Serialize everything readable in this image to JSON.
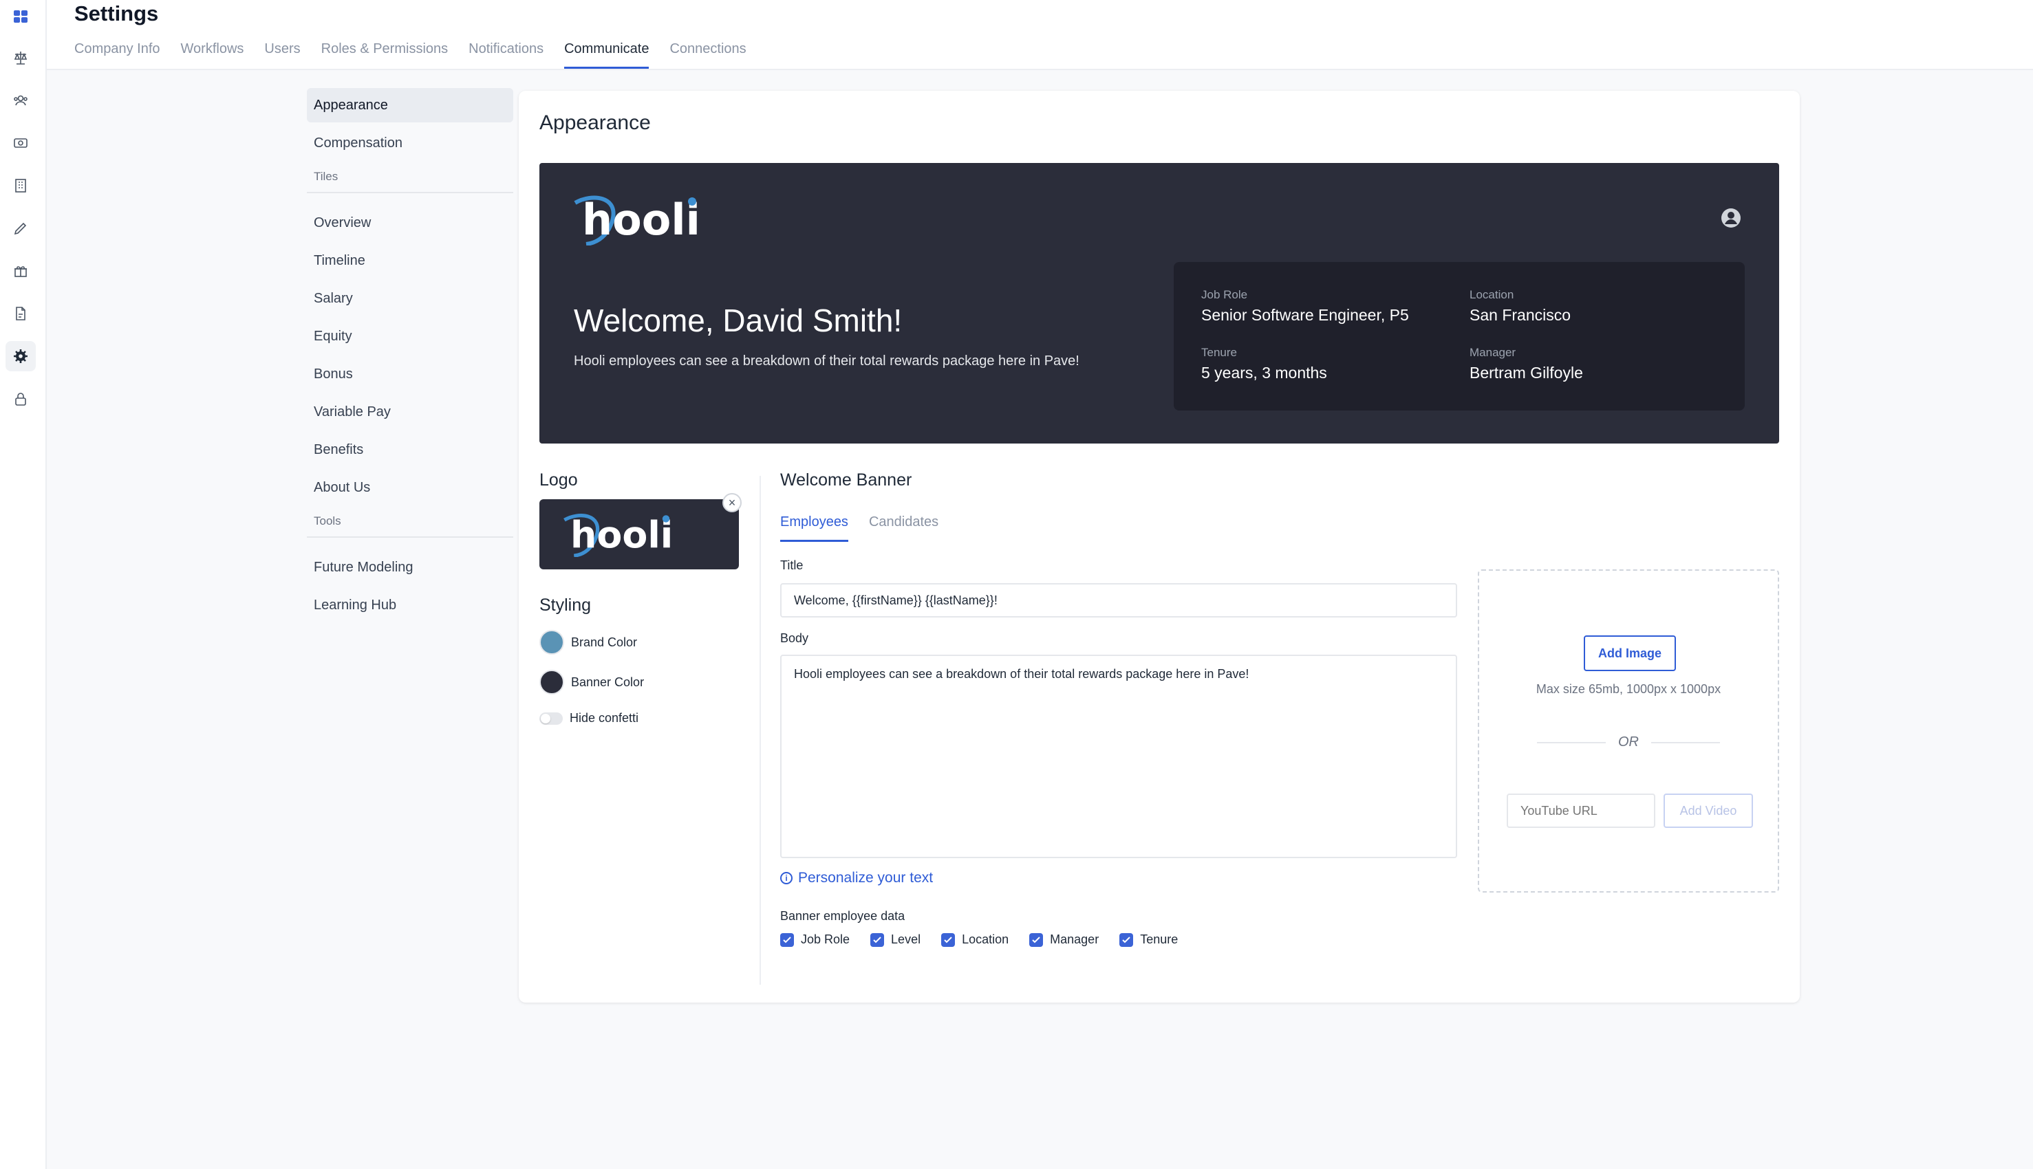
{
  "rail": {
    "icons": [
      "dashboard-icon",
      "scale-icon",
      "people-icon",
      "money-icon",
      "building-icon",
      "pen-icon",
      "gift-icon",
      "document-icon",
      "gear-icon",
      "lock-icon"
    ]
  },
  "header": {
    "title": "Settings",
    "tabs": [
      {
        "label": "Company Info"
      },
      {
        "label": "Workflows"
      },
      {
        "label": "Users"
      },
      {
        "label": "Roles & Permissions"
      },
      {
        "label": "Notifications"
      },
      {
        "label": "Communicate",
        "active": true
      },
      {
        "label": "Connections"
      }
    ]
  },
  "subnav": {
    "items": [
      "Appearance",
      "Compensation"
    ],
    "tiles_label": "Tiles",
    "tiles": [
      "Overview",
      "Timeline",
      "Salary",
      "Equity",
      "Bonus",
      "Variable Pay",
      "Benefits",
      "About Us"
    ],
    "tools_label": "Tools",
    "tools": [
      "Future Modeling",
      "Learning Hub"
    ]
  },
  "main": {
    "title": "Appearance",
    "banner": {
      "logo_text": "hooli",
      "welcome_title": "Welcome, David Smith!",
      "welcome_body": "Hooli employees can see a breakdown of their total rewards package here in Pave!",
      "info": {
        "job_role_label": "Job Role",
        "job_role_value": "Senior Software Engineer, P5",
        "location_label": "Location",
        "location_value": "San Francisco",
        "tenure_label": "Tenure",
        "tenure_value": "5 years, 3 months",
        "manager_label": "Manager",
        "manager_value": "Bertram Gilfoyle"
      }
    },
    "logo": {
      "heading": "Logo",
      "logo_text": "hooli",
      "remove_glyph": "×"
    },
    "styling": {
      "heading": "Styling",
      "brand_color_label": "Brand Color",
      "brand_color": "#5a93b5",
      "banner_color_label": "Banner Color",
      "banner_color": "#2b2d3a",
      "hide_confetti_label": "Hide confetti"
    },
    "welcome_banner": {
      "heading": "Welcome Banner",
      "tabs": [
        "Employees",
        "Candidates"
      ],
      "title_label": "Title",
      "title_value": "Welcome, {{firstName}} {{lastName}}!",
      "body_label": "Body",
      "body_value": "Hooli employees can see a breakdown of their total rewards package here in Pave!",
      "personalize_label": "Personalize your text",
      "banner_data_label": "Banner employee data",
      "checks": [
        "Job Role",
        "Level",
        "Location",
        "Manager",
        "Tenure"
      ]
    },
    "media": {
      "add_image_label": "Add Image",
      "max_size": "Max size 65mb, 1000px x 1000px",
      "or_label": "OR",
      "youtube_placeholder": "YouTube URL",
      "add_video_label": "Add Video"
    }
  },
  "colors": {
    "accent": "#2f5cd6",
    "banner_bg": "#2b2d3a",
    "logo_blue": "#3d8fd1"
  }
}
